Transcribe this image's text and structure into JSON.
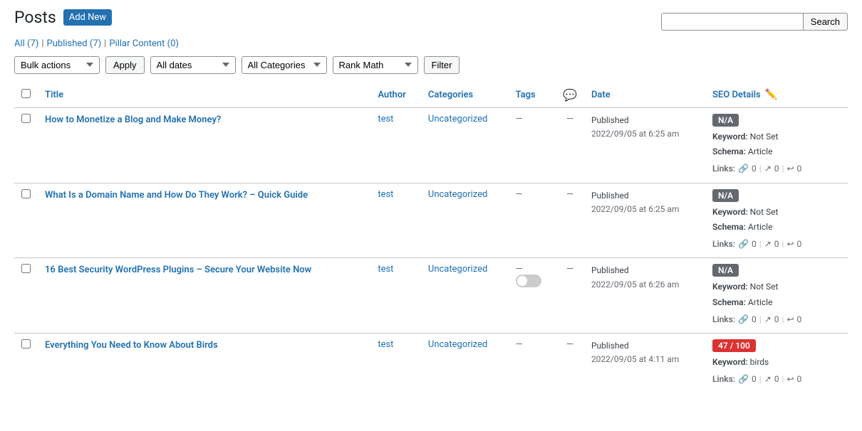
{
  "page": {
    "title": "Posts",
    "add_new_label": "Add New"
  },
  "sub_nav": {
    "all_label": "All",
    "all_count": "7",
    "published_label": "Published",
    "published_count": "7",
    "pillar_label": "Pillar Content",
    "pillar_count": "0"
  },
  "search": {
    "placeholder": "",
    "button_label": "Search"
  },
  "filters": {
    "bulk_actions_label": "Bulk actions",
    "apply_label": "Apply",
    "all_dates_label": "All dates",
    "all_categories_label": "All Categories",
    "rank_math_label": "Rank Math",
    "filter_label": "Filter"
  },
  "table": {
    "headers": {
      "title": "Title",
      "author": "Author",
      "categories": "Categories",
      "tags": "Tags",
      "comments": "💬",
      "date": "Date",
      "seo_details": "SEO Details"
    },
    "rows": [
      {
        "id": 1,
        "title": "How to Monetize a Blog and Make Money?",
        "author": "test",
        "categories": "Uncategorized",
        "tags": "—",
        "comments": "—",
        "date_status": "Published",
        "date": "2022/09/05 at 6:25 am",
        "seo_badge": "N/A",
        "seo_badge_type": "na",
        "keyword_label": "Keyword:",
        "keyword_value": "Not Set",
        "schema_label": "Schema:",
        "schema_value": "Article",
        "links_label": "Links:",
        "links_internal": "0",
        "links_external": "0",
        "links_incoming": "0"
      },
      {
        "id": 2,
        "title": "What Is a Domain Name and How Do They Work? – Quick Guide",
        "author": "test",
        "categories": "Uncategorized",
        "tags": "—",
        "comments": "—",
        "date_status": "Published",
        "date": "2022/09/05 at 6:25 am",
        "seo_badge": "N/A",
        "seo_badge_type": "na",
        "keyword_label": "Keyword:",
        "keyword_value": "Not Set",
        "schema_label": "Schema:",
        "schema_value": "Article",
        "links_label": "Links:",
        "links_internal": "0",
        "links_external": "0",
        "links_incoming": "0"
      },
      {
        "id": 3,
        "title": "16 Best Security WordPress Plugins – Secure Your Website Now",
        "author": "test",
        "categories": "Uncategorized",
        "tags": "—",
        "comments": "—",
        "date_status": "Published",
        "date": "2022/09/05 at 6:26 am",
        "seo_badge": "N/A",
        "seo_badge_type": "na",
        "keyword_label": "Keyword:",
        "keyword_value": "Not Set",
        "schema_label": "Schema:",
        "schema_value": "Article",
        "links_label": "Links:",
        "links_internal": "0",
        "links_external": "0",
        "links_incoming": "0",
        "has_toggle": true
      },
      {
        "id": 4,
        "title": "Everything You Need to Know About Birds",
        "author": "test",
        "categories": "Uncategorized",
        "tags": "—",
        "comments": "—",
        "date_status": "Published",
        "date": "2022/09/05 at 4:11 am",
        "seo_badge": "47 / 100",
        "seo_badge_type": "score",
        "keyword_label": "Keyword:",
        "keyword_value": "birds",
        "schema_label": "Schema:",
        "schema_value": "",
        "links_label": "Links:",
        "links_internal": "0",
        "links_external": "0",
        "links_incoming": "0"
      }
    ]
  }
}
